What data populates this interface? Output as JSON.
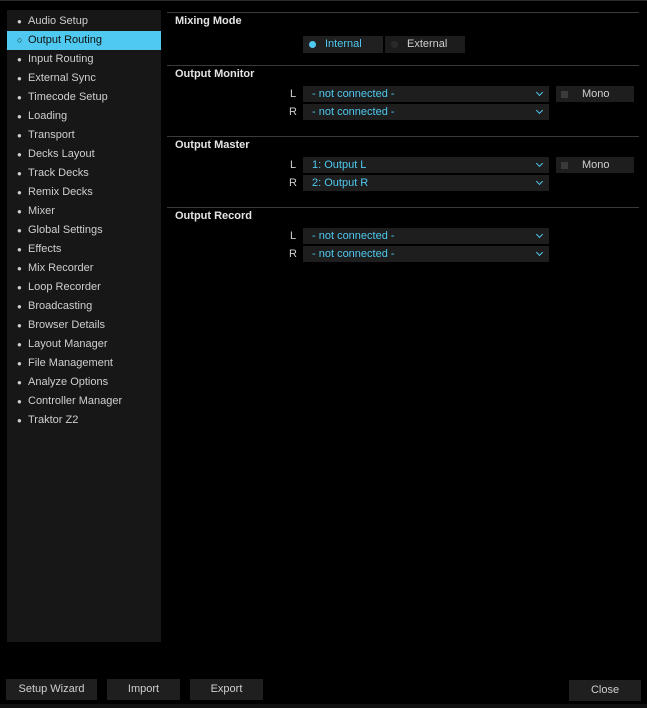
{
  "sidebar": {
    "items": [
      {
        "label": "Audio Setup",
        "active": false
      },
      {
        "label": "Output Routing",
        "active": true
      },
      {
        "label": "Input Routing",
        "active": false
      },
      {
        "label": "External Sync",
        "active": false
      },
      {
        "label": "Timecode Setup",
        "active": false
      },
      {
        "label": "Loading",
        "active": false
      },
      {
        "label": "Transport",
        "active": false
      },
      {
        "label": "Decks Layout",
        "active": false
      },
      {
        "label": "Track Decks",
        "active": false
      },
      {
        "label": "Remix Decks",
        "active": false
      },
      {
        "label": "Mixer",
        "active": false
      },
      {
        "label": "Global Settings",
        "active": false
      },
      {
        "label": "Effects",
        "active": false
      },
      {
        "label": "Mix Recorder",
        "active": false
      },
      {
        "label": "Loop Recorder",
        "active": false
      },
      {
        "label": "Broadcasting",
        "active": false
      },
      {
        "label": "Browser Details",
        "active": false
      },
      {
        "label": "Layout Manager",
        "active": false
      },
      {
        "label": "File Management",
        "active": false
      },
      {
        "label": "Analyze Options",
        "active": false
      },
      {
        "label": "Controller Manager",
        "active": false
      },
      {
        "label": "Traktor Z2",
        "active": false
      }
    ]
  },
  "mixing_mode": {
    "title": "Mixing Mode",
    "internal_label": "Internal",
    "external_label": "External",
    "selected": "Internal"
  },
  "output_monitor": {
    "title": "Output Monitor",
    "left_label": "L",
    "right_label": "R",
    "left_value": "- not connected -",
    "right_value": "- not connected -",
    "mono_label": "Mono"
  },
  "output_master": {
    "title": "Output Master",
    "left_label": "L",
    "right_label": "R",
    "left_value": "1: Output L",
    "right_value": "2: Output R",
    "mono_label": "Mono"
  },
  "output_record": {
    "title": "Output Record",
    "left_label": "L",
    "right_label": "R",
    "left_value": "- not connected -",
    "right_value": "- not connected -"
  },
  "footer": {
    "setup_wizard": "Setup Wizard",
    "import": "Import",
    "export": "Export",
    "close": "Close"
  },
  "colors": {
    "accent": "#4fc9ef",
    "panel": "#171717",
    "background": "#000000"
  }
}
